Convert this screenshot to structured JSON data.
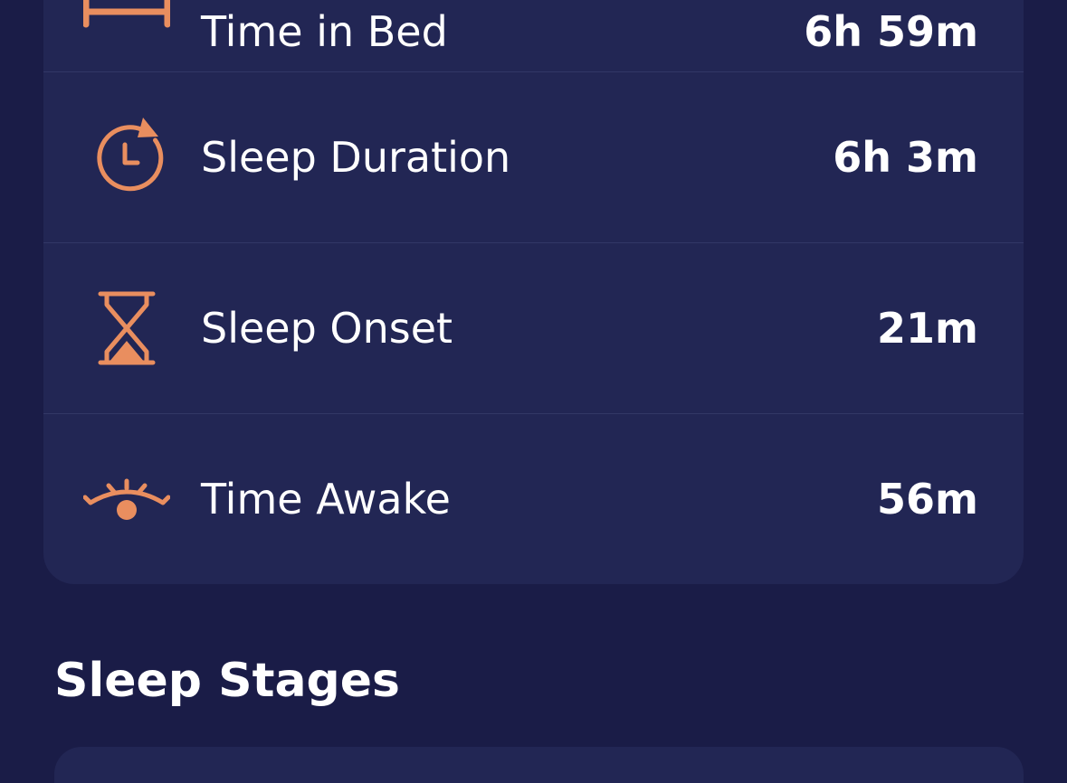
{
  "accent_color": "#e98e5f",
  "metrics": [
    {
      "icon": "bed-icon",
      "label": "Time in Bed",
      "value": "6h 59m"
    },
    {
      "icon": "clock-refresh-icon",
      "label": "Sleep Duration",
      "value": "6h 3m"
    },
    {
      "icon": "hourglass-icon",
      "label": "Sleep Onset",
      "value": "21m"
    },
    {
      "icon": "eye-awake-icon",
      "label": "Time Awake",
      "value": "56m"
    }
  ],
  "sleep_stages": {
    "title": "Sleep Stages"
  }
}
